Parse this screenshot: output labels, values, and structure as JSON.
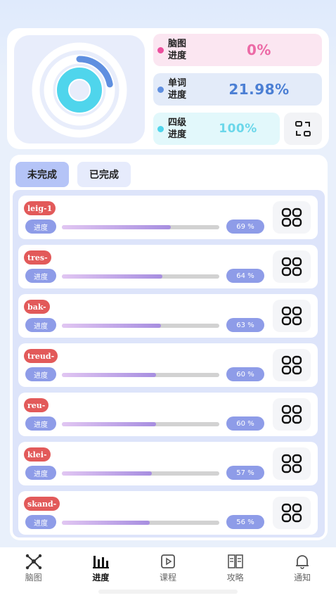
{
  "stats": {
    "brain": {
      "label_line1": "脑图",
      "label_line2": "进度",
      "value": "0%",
      "color": "#ec4f9d"
    },
    "word": {
      "label_line1": "单词",
      "label_line2": "进度",
      "value": "21.98%",
      "color": "#5f8fe0"
    },
    "cet4": {
      "label_line1": "四级",
      "label_line2": "进度",
      "value": "100%",
      "color": "#4fd5ec"
    }
  },
  "ring_chart": {
    "rings": [
      {
        "name": "outer",
        "fraction": 0.0,
        "color": "#ec4f9d"
      },
      {
        "name": "middle",
        "fraction": 0.2198,
        "color": "#5f8fe0"
      },
      {
        "name": "inner",
        "fraction": 1.0,
        "color": "#4fd5ec"
      }
    ]
  },
  "tabs": {
    "incomplete": "未完成",
    "complete": "已完成"
  },
  "items": [
    {
      "tag": "leig-1",
      "progress_label": "进度",
      "percent_text": "69 %",
      "fraction": 0.69
    },
    {
      "tag": "tres-",
      "progress_label": "进度",
      "percent_text": "64 %",
      "fraction": 0.64
    },
    {
      "tag": "bak-",
      "progress_label": "进度",
      "percent_text": "63 %",
      "fraction": 0.63
    },
    {
      "tag": "treud-",
      "progress_label": "进度",
      "percent_text": "60 %",
      "fraction": 0.6
    },
    {
      "tag": "reu-",
      "progress_label": "进度",
      "percent_text": "60 %",
      "fraction": 0.6
    },
    {
      "tag": "klei-",
      "progress_label": "进度",
      "percent_text": "57 %",
      "fraction": 0.57
    },
    {
      "tag": "skand-",
      "progress_label": "进度",
      "percent_text": "56 %",
      "fraction": 0.56
    }
  ],
  "nav": [
    {
      "label": "脑图",
      "icon": "mindmap-icon",
      "active": false
    },
    {
      "label": "进度",
      "icon": "bar-chart-icon",
      "active": true
    },
    {
      "label": "课程",
      "icon": "play-icon",
      "active": false
    },
    {
      "label": "攻略",
      "icon": "book-icon",
      "active": false
    },
    {
      "label": "通知",
      "icon": "bell-icon",
      "active": false
    }
  ]
}
